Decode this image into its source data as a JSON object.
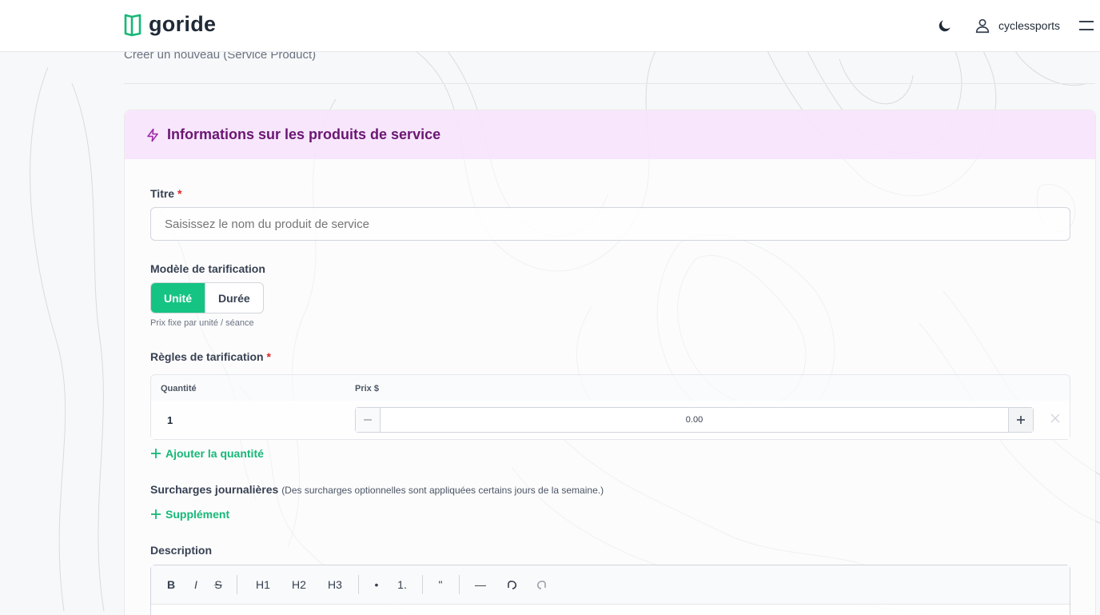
{
  "header": {
    "brand": "goride",
    "username": "cyclessports",
    "icons": [
      "logo-icon",
      "moon-icon",
      "user-icon",
      "menu-icon"
    ]
  },
  "breadcrumb": "Créer un nouveau (Service Product)",
  "card": {
    "title": "Informations sur les produits de service",
    "title_color": "#6b1673",
    "header_bg": "#f6e2fc"
  },
  "form": {
    "title_label": "Titre",
    "title_required": "*",
    "title_placeholder": "Saisissez le nom du produit de service",
    "title_value": "",
    "pricing_model_label": "Modèle de tarification",
    "pricing_options": [
      "Unité",
      "Durée"
    ],
    "pricing_selected": "Unité",
    "pricing_hint": "Prix fixe par unité / séance",
    "rules_label": "Règles de tarification",
    "rules_required": "*",
    "rules_columns": [
      "Quantité",
      "Prix $"
    ],
    "rules_rows": [
      {
        "quantity": "1",
        "price": "0.00"
      }
    ],
    "add_quantity": "Ajouter la quantité",
    "surcharges_label": "Surcharges journalières",
    "surcharges_note": "(Des surcharges optionnelles sont appliquées certains jours de la semaine.)",
    "add_supplement": "Supplément",
    "description_label": "Description"
  },
  "editor_toolbar": {
    "bold": "B",
    "italic": "I",
    "strike": "S",
    "h1": "H1",
    "h2": "H2",
    "h3": "H3",
    "bullet": "•",
    "ordered": "1.",
    "quote": "\"",
    "hr": "—",
    "undo": "undo-icon",
    "redo": "redo-icon"
  },
  "colors": {
    "accent": "#15c482",
    "link": "#16b877",
    "required": "#dc2626"
  }
}
